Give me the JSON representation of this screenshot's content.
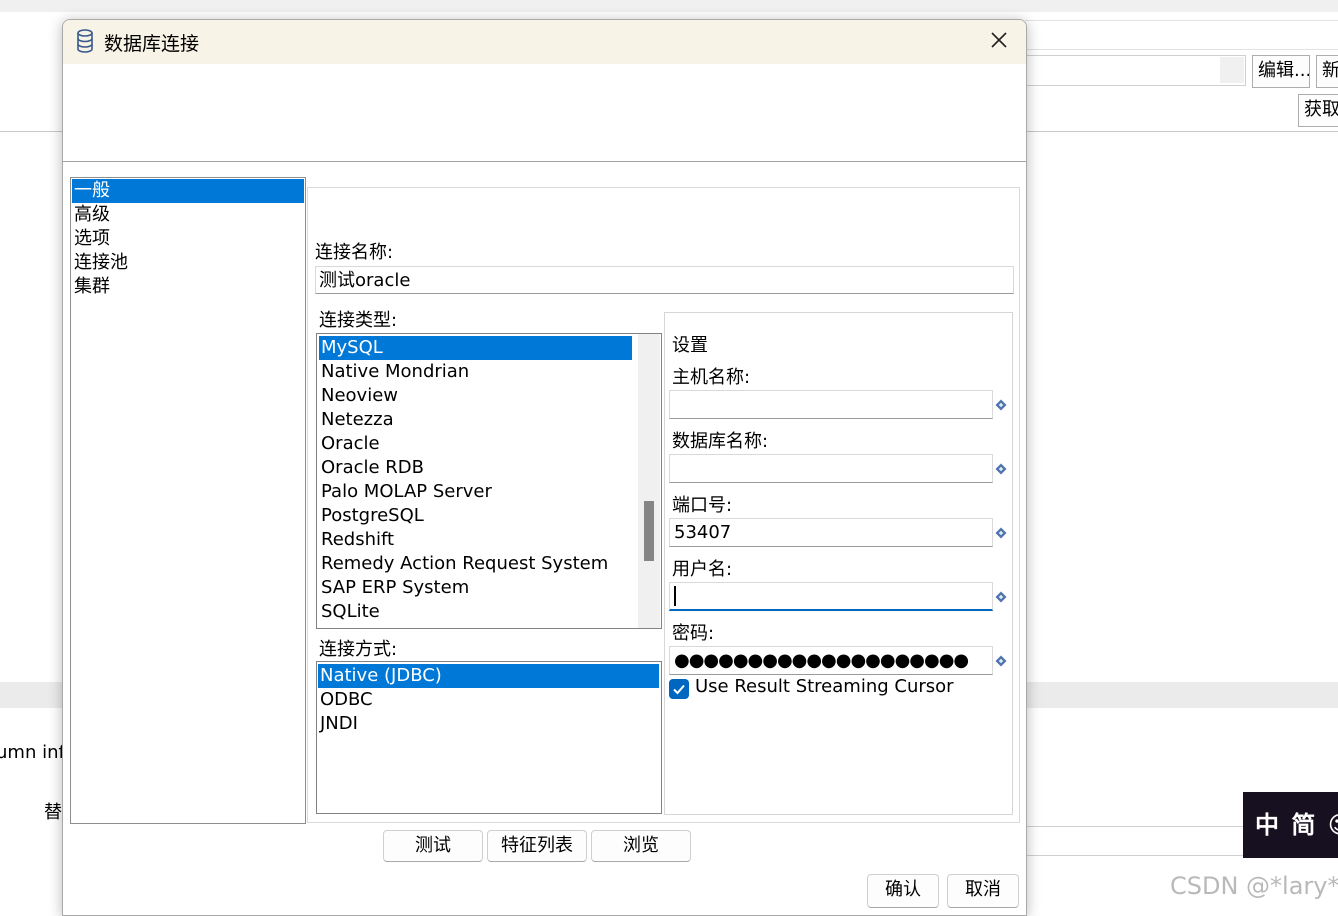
{
  "background": {
    "edit_button": "编辑...",
    "new_button": "新",
    "fetch_button": "获取",
    "column_text": "umn inf",
    "replace_text": "替",
    "ime_text": "中 简 ☺",
    "watermark": "CSDN @*lary*"
  },
  "dialog": {
    "title": "数据库连接",
    "title_icon": "database-icon",
    "close_icon": "close-icon",
    "nav": [
      "一般",
      "高级",
      "选项",
      "连接池",
      "集群"
    ],
    "nav_selected": "一般",
    "general": {
      "connection_name_label": "连接名称:",
      "connection_name_value": "测试oracle",
      "connection_type_label": "连接类型:",
      "connection_types": [
        "MySQL",
        "Native Mondrian",
        "Neoview",
        "Netezza",
        "Oracle",
        "Oracle RDB",
        "Palo MOLAP Server",
        "PostgreSQL",
        "Redshift",
        "Remedy Action Request System",
        "SAP ERP System",
        "SQLite"
      ],
      "connection_type_selected": "MySQL",
      "access_label": "连接方式:",
      "access_methods": [
        "Native (JDBC)",
        "ODBC",
        "JNDI"
      ],
      "access_selected": "Native (JDBC)",
      "settings": {
        "section_label": "设置",
        "host_label": "主机名称:",
        "host_value": "",
        "database_label": "数据库名称:",
        "database_value": "",
        "port_label": "端口号:",
        "port_value": "53407",
        "username_label": "用户名:",
        "username_value": "",
        "password_label": "密码:",
        "password_value": "●●●●●●●●●●●●●●●●●●●●",
        "streaming_label": "Use Result Streaming Cursor",
        "streaming_checked": true
      }
    },
    "buttons": {
      "test": "测试",
      "features": "特征列表",
      "explore": "浏览",
      "ok": "确认",
      "cancel": "取消"
    },
    "colors": {
      "selection": "#0078d7",
      "titlebar": "#f8f3e7",
      "checkbox": "#0067c0"
    }
  }
}
